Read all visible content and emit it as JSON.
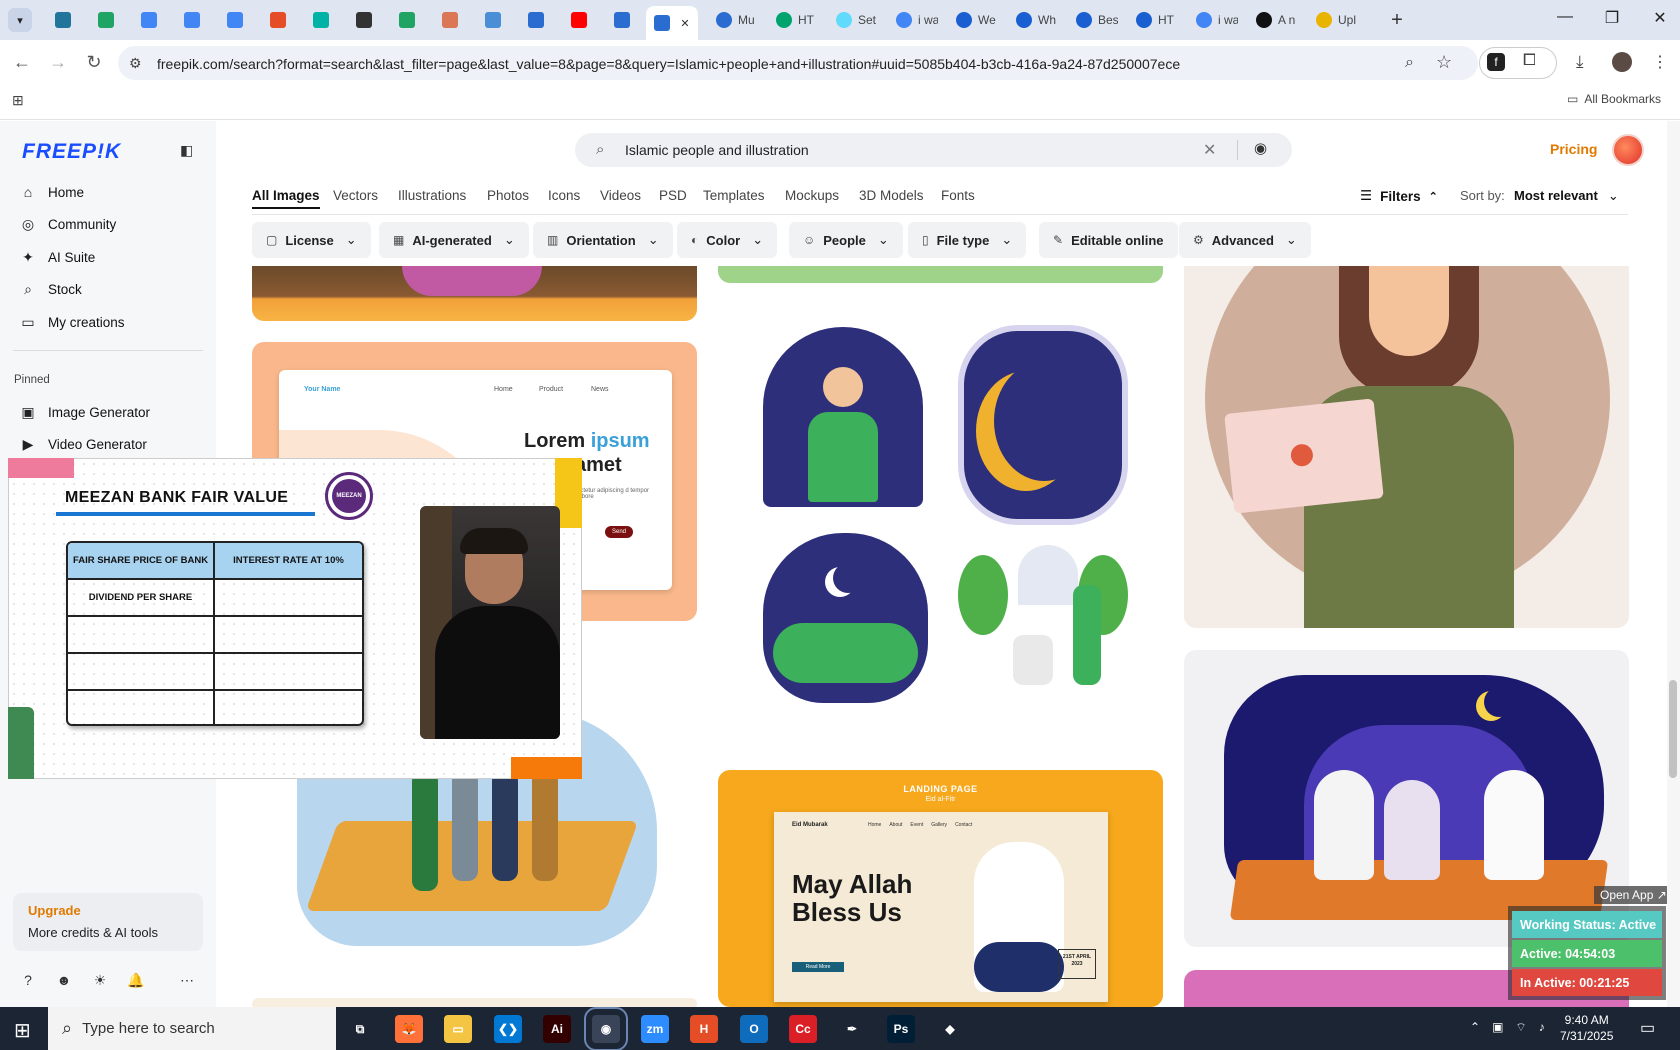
{
  "browser": {
    "tabs": [
      {
        "icon": "wordpress-icon",
        "color": "#21759b"
      },
      {
        "icon": "sheets-icon",
        "color": "#1fa463"
      },
      {
        "icon": "docs-icon",
        "color": "#4285f4"
      },
      {
        "icon": "docs-icon",
        "color": "#4285f4"
      },
      {
        "icon": "docs-icon",
        "color": "#4285f4"
      },
      {
        "icon": "html5-icon",
        "color": "#e44d26"
      },
      {
        "icon": "app-icon",
        "color": "#00b3a6"
      },
      {
        "icon": "openai-icon",
        "color": "#333333"
      },
      {
        "icon": "sheets-icon",
        "color": "#1fa463"
      },
      {
        "icon": "claude-icon",
        "color": "#d97757"
      },
      {
        "icon": "grid-icon",
        "color": "#4a8fd6"
      },
      {
        "icon": "word-icon",
        "color": "#2b6cd1"
      },
      {
        "icon": "youtube-icon",
        "color": "#ff0000"
      },
      {
        "icon": "word-icon",
        "color": "#2b6cd1"
      }
    ],
    "active_tab_close": "✕",
    "wide_tabs": [
      {
        "label": "Mu",
        "icon": "word-icon",
        "color": "#2b6cd1"
      },
      {
        "label": "HT",
        "icon": "w-icon",
        "color": "#00a36c"
      },
      {
        "label": "Set",
        "icon": "react-icon",
        "color": "#61dafb"
      },
      {
        "label": "i wa",
        "icon": "google-icon",
        "color": "#4285f4"
      },
      {
        "label": "We",
        "icon": "c-icon",
        "color": "#1a5fd1"
      },
      {
        "label": "Wh",
        "icon": "c-icon",
        "color": "#1a5fd1"
      },
      {
        "label": "Bes",
        "icon": "c-icon",
        "color": "#1a5fd1"
      },
      {
        "label": "HT",
        "icon": "c-icon",
        "color": "#1a5fd1"
      },
      {
        "label": "i wa",
        "icon": "google-icon",
        "color": "#4285f4"
      },
      {
        "label": "A n",
        "icon": "anthropic-icon",
        "color": "#111111"
      },
      {
        "label": "Upl",
        "icon": "upload-icon",
        "color": "#e8b400"
      }
    ],
    "new_tab": "+",
    "url": "freepik.com/search?format=search&last_filter=page&last_value=8&page=8&query=Islamic+people+and+illustration#uuid=5085b404-b3cb-416a-9a24-87d250007ece",
    "bookmarks_label": "All Bookmarks"
  },
  "sidebar": {
    "logo": "FREEP!K",
    "items": [
      {
        "label": "Home",
        "icon": "home-icon",
        "glyph": "⌂"
      },
      {
        "label": "Community",
        "icon": "globe-icon",
        "glyph": "◎"
      },
      {
        "label": "AI Suite",
        "icon": "sparkle-icon",
        "glyph": "✦"
      },
      {
        "label": "Stock",
        "icon": "search-icon",
        "glyph": "⌕"
      },
      {
        "label": "My creations",
        "icon": "folder-icon",
        "glyph": "▭"
      }
    ],
    "pinned_label": "Pinned",
    "pinned": [
      {
        "label": "Image Generator",
        "icon": "image-icon",
        "glyph": "▣"
      },
      {
        "label": "Video Generator",
        "icon": "video-icon",
        "glyph": "▶"
      }
    ],
    "upgrade_title": "Upgrade",
    "upgrade_sub": "More credits & AI tools"
  },
  "header": {
    "search_value": "Islamic people and illustration",
    "pricing": "Pricing"
  },
  "categories": [
    "All Images",
    "Vectors",
    "Illustrations",
    "Photos",
    "Icons",
    "Videos",
    "PSD",
    "Templates",
    "Mockups",
    "3D Models",
    "Fonts"
  ],
  "filters_label": "Filters",
  "sort_label": "Sort by:",
  "sort_value": "Most relevant",
  "chips": [
    {
      "label": "License",
      "icon": "license-icon",
      "glyph": "▢"
    },
    {
      "label": "AI-generated",
      "icon": "ai-icon",
      "glyph": "▦"
    },
    {
      "label": "Orientation",
      "icon": "orientation-icon",
      "glyph": "▥"
    },
    {
      "label": "Color",
      "icon": "palette-icon",
      "glyph": "◐"
    },
    {
      "label": "People",
      "icon": "people-icon",
      "glyph": "☺"
    },
    {
      "label": "File type",
      "icon": "file-icon",
      "glyph": "▯"
    },
    {
      "label": "Editable online",
      "icon": "pencil-icon",
      "glyph": "✎"
    },
    {
      "label": "Advanced",
      "icon": "gear-icon",
      "glyph": "⚙"
    }
  ],
  "cards": {
    "landing_lorem": {
      "nav_name": "Your Name",
      "nav_items": [
        "Home",
        "Product",
        "News"
      ],
      "title_a": "Lorem",
      "title_b": "ipsum",
      "title_c": "amet",
      "body": "ectetur adipiscing d tempor labore",
      "button": "Send"
    },
    "eid_landing": {
      "top": "LANDING PAGE",
      "sub": "Eid al-Fitr",
      "brand": "Eid Mubarak",
      "nav": [
        "Home",
        "About",
        "Event",
        "Gallery",
        "Contact"
      ],
      "headline": "May Allah Bless Us",
      "cta": "Read More",
      "date": "21ST APRIL 2023"
    }
  },
  "overlay": {
    "title": "MEEZAN BANK FAIR VALUE",
    "logo_text": "MEEZAN BANK",
    "table": [
      [
        "FAIR SHARE PRICE OF BANK",
        "INTEREST RATE AT 10%"
      ],
      [
        "DIVIDEND PER SHARE",
        ""
      ],
      [
        "",
        ""
      ],
      [
        "",
        ""
      ],
      [
        "",
        ""
      ]
    ]
  },
  "status_widget": {
    "open_app": "Open App ↗",
    "working": "Working Status: Active",
    "active": "Active: 04:54:03",
    "inactive": "In Active: 00:21:25",
    "colors": {
      "working": "#56c9c2",
      "active": "#4cc06a",
      "inactive": "#e0483f"
    }
  },
  "taskbar": {
    "search_placeholder": "Type here to search",
    "time": "9:40 AM",
    "date": "7/31/2025",
    "apps": [
      {
        "name": "task-view-icon",
        "label": "⧉",
        "color": "#1c2533"
      },
      {
        "name": "firefox-icon",
        "label": "🦊",
        "color": "#ff7139"
      },
      {
        "name": "file-explorer-icon",
        "label": "▭",
        "color": "#f4c542"
      },
      {
        "name": "vscode-icon",
        "label": "❮❯",
        "color": "#0078d4"
      },
      {
        "name": "illustrator-icon",
        "label": "Ai",
        "color": "#330000"
      },
      {
        "name": "chrome-icon",
        "label": "◉",
        "color": "#3a4458"
      },
      {
        "name": "zoom-icon",
        "label": "zm",
        "color": "#2d8cff"
      },
      {
        "name": "html-editor-icon",
        "label": "H",
        "color": "#e44d26"
      },
      {
        "name": "outlook-icon",
        "label": "O",
        "color": "#0f6cbd"
      },
      {
        "name": "creative-cloud-icon",
        "label": "Cc",
        "color": "#da1f26"
      },
      {
        "name": "pen-tool-icon",
        "label": "✒",
        "color": "#1c2533"
      },
      {
        "name": "photoshop-icon",
        "label": "Ps",
        "color": "#001e36"
      },
      {
        "name": "app-icon",
        "label": "◆",
        "color": "#1c2533"
      }
    ]
  }
}
